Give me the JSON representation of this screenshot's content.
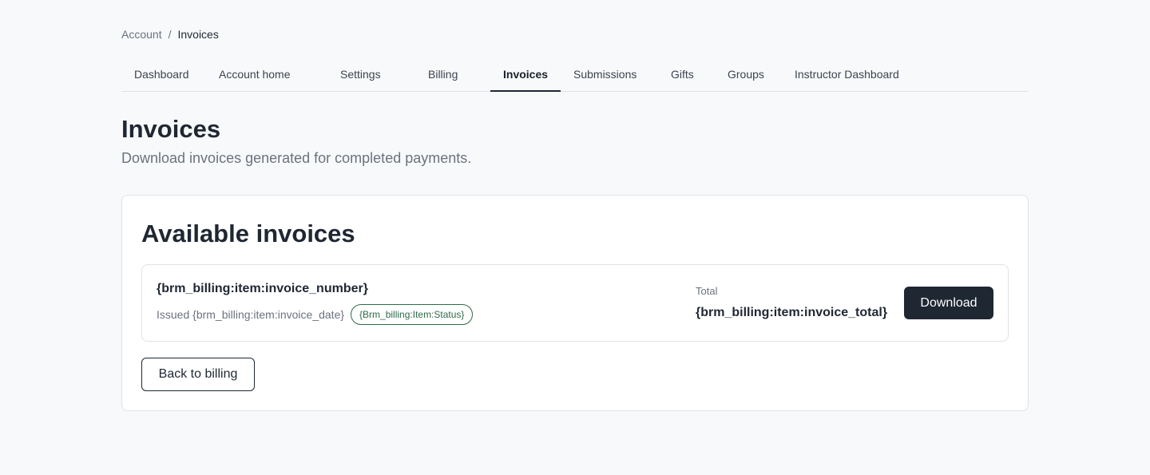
{
  "breadcrumb": {
    "parent": "Account",
    "separator": "/",
    "current": "Invoices"
  },
  "tabs": [
    {
      "label": "Dashboard",
      "active": false
    },
    {
      "label": "Account home",
      "active": false
    },
    {
      "label": "Settings",
      "active": false
    },
    {
      "label": "Billing",
      "active": false
    },
    {
      "label": "Invoices",
      "active": true
    },
    {
      "label": "Submissions",
      "active": false
    },
    {
      "label": "Gifts",
      "active": false
    },
    {
      "label": "Groups",
      "active": false
    },
    {
      "label": "Instructor Dashboard",
      "active": false
    }
  ],
  "page": {
    "title": "Invoices",
    "subtitle": "Download invoices generated for completed payments."
  },
  "card": {
    "title": "Available invoices",
    "invoice": {
      "number": "{brm_billing:item:invoice_number}",
      "issued": "Issued {brm_billing:item:invoice_date}",
      "status": "{Brm_billing:Item:Status}",
      "total_label": "Total",
      "total_value": "{brm_billing:item:invoice_total}",
      "download_label": "Download"
    },
    "back_label": "Back to billing"
  },
  "colors": {
    "primary": "#1f2733",
    "muted_text": "#6b7280",
    "status_green": "#2f6b48",
    "border": "#dfe2e6",
    "background": "#f8f9fa"
  }
}
